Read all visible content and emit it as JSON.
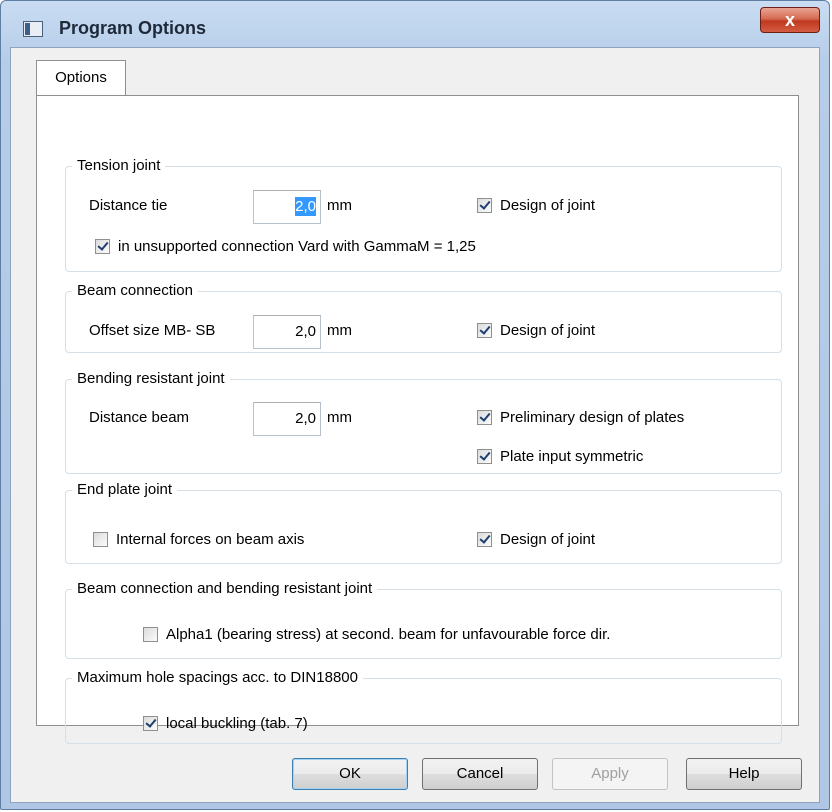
{
  "window": {
    "title": "Program Options",
    "close_glyph": "x"
  },
  "tabs": [
    {
      "label": "Options"
    }
  ],
  "groups": {
    "tension": {
      "label": "Tension joint",
      "distance_tie_label": "Distance tie",
      "distance_tie_value": "2,0",
      "unit": "mm",
      "design_label": "Design of joint",
      "design_checked": true,
      "unsupported_label": "in unsupported connection Vard   with  GammaM = 1,25",
      "unsupported_checked": true
    },
    "beam": {
      "label": "Beam connection",
      "offset_label": "Offset size MB- SB",
      "offset_value": "2,0",
      "unit": "mm",
      "design_label": "Design of joint",
      "design_checked": true
    },
    "bending": {
      "label": "Bending resistant joint",
      "distance_beam_label": "Distance beam",
      "distance_beam_value": "2,0",
      "unit": "mm",
      "prelim_label": "Preliminary design of plates",
      "prelim_checked": true,
      "symmetric_label": "Plate input  symmetric",
      "symmetric_checked": true
    },
    "endplate": {
      "label": "End plate joint",
      "internal_label": "Internal forces on beam axis",
      "internal_checked": false,
      "design_label": "Design of joint",
      "design_checked": true
    },
    "beam_bending": {
      "label": "Beam connection and bending resistant joint",
      "alpha_label": "Alpha1 (bearing stress) at second. beam for unfavourable force dir.",
      "alpha_checked": false
    },
    "hole": {
      "label": "Maximum hole spacings acc. to DIN18800",
      "buckling_label": "local buckling (tab. 7)",
      "buckling_checked": true
    }
  },
  "buttons": {
    "ok": "OK",
    "cancel": "Cancel",
    "apply": "Apply",
    "help": "Help"
  }
}
